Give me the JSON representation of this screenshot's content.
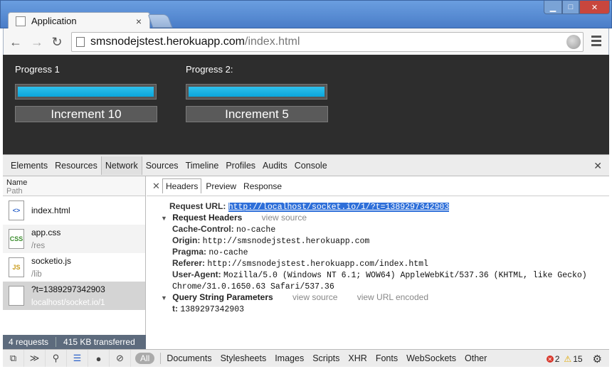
{
  "window": {
    "tab_title": "Application",
    "tab_close": "×"
  },
  "toolbar": {
    "url_host": "smsnodejstest.herokuapp.com",
    "url_path": "/index.html"
  },
  "page": {
    "progress": [
      {
        "label": "Progress 1",
        "button": "Increment 10",
        "fill": 1.0
      },
      {
        "label": "Progress 2:",
        "button": "Increment 5",
        "fill": 1.0
      }
    ]
  },
  "devtools": {
    "tabs": [
      "Elements",
      "Resources",
      "Network",
      "Sources",
      "Timeline",
      "Profiles",
      "Audits",
      "Console"
    ],
    "active_tab": "Network",
    "list_header": {
      "name": "Name",
      "path": "Path"
    },
    "requests": [
      {
        "name": "index.html",
        "path": "",
        "type": "html"
      },
      {
        "name": "app.css",
        "path": "/res",
        "type": "CSS"
      },
      {
        "name": "socketio.js",
        "path": "/lib",
        "type": "JS"
      },
      {
        "name": "?t=1389297342903",
        "path": "localhost/socket.io/1",
        "type": "doc"
      }
    ],
    "status": {
      "requests": "4 requests",
      "transferred": "415 KB transferred"
    },
    "detail_tabs": [
      "Headers",
      "Preview",
      "Response"
    ],
    "headers": {
      "request_url_label": "Request URL:",
      "request_url": "http://localhost/socket.io/1/?t=1389297342903",
      "request_headers_label": "Request Headers",
      "view_source": "view source",
      "items": [
        {
          "k": "Cache-Control:",
          "v": "no-cache"
        },
        {
          "k": "Origin:",
          "v": "http://smsnodejstest.herokuapp.com"
        },
        {
          "k": "Pragma:",
          "v": "no-cache"
        },
        {
          "k": "Referer:",
          "v": "http://smsnodejstest.herokuapp.com/index.html"
        },
        {
          "k": "User-Agent:",
          "v": "Mozilla/5.0 (Windows NT 6.1; WOW64) AppleWebKit/537.36 (KHTML, like Gecko)"
        }
      ],
      "ua_cont": "Chrome/31.0.1650.63 Safari/537.36",
      "query_label": "Query String Parameters",
      "view_source_2": "view source",
      "view_url_encoded": "view URL encoded",
      "query_items": [
        {
          "k": "t:",
          "v": "1389297342903"
        }
      ]
    },
    "filters": {
      "all": "All",
      "types": [
        "Documents",
        "Stylesheets",
        "Images",
        "Scripts",
        "XHR",
        "Fonts",
        "WebSockets",
        "Other"
      ],
      "errors": "2",
      "warnings": "15"
    }
  }
}
